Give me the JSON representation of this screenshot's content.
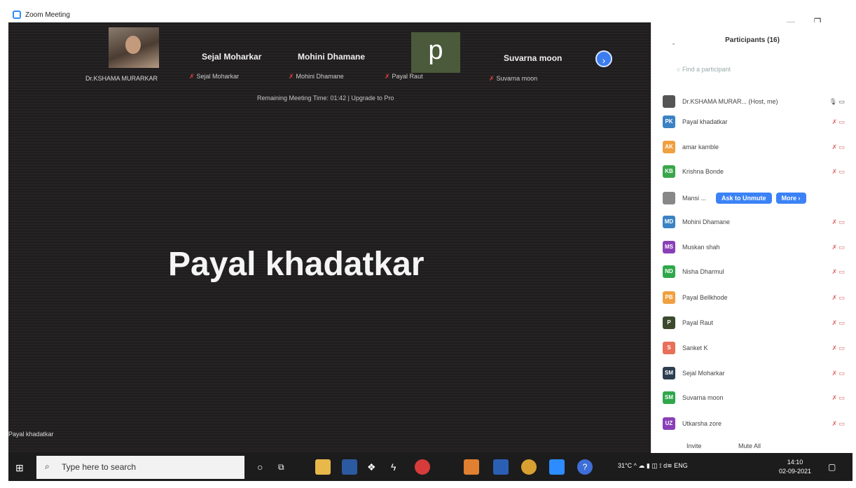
{
  "window": {
    "title": "Zoom Meeting"
  },
  "thumbnails": [
    {
      "name": "Dr.KSHAMA MURARKAR"
    },
    {
      "name": "Sejal Moharkar",
      "sub": "Sejal Moharkar"
    },
    {
      "name": "Mohini Dhamane",
      "sub": "Mohini Dhamane"
    },
    {
      "name": "p",
      "sub": "Payal Raut"
    },
    {
      "name": "Suvarna moon",
      "sub": "Suvarna moon"
    }
  ],
  "next_icon": "›",
  "remaining": "Remaining Meeting Time: 01:42 | Upgrade to Pro",
  "active_speaker": "Payal khadatkar",
  "active_label": "Payal khadatkar",
  "panel": {
    "title": "Participants (16)",
    "find_placeholder": "Find a participant",
    "participants": [
      {
        "initials": "",
        "name": "Dr.KSHAMA MURAR...  (Host, me)",
        "color": "#555555"
      },
      {
        "initials": "PK",
        "name": "Payal khadatkar",
        "color": "#3b82c4"
      },
      {
        "initials": "AK",
        "name": "amar kamble",
        "color": "#f0a040"
      },
      {
        "initials": "KB",
        "name": "Krishna Bonde",
        "color": "#3aa64a"
      },
      {
        "initials": "",
        "name": "Mansi ...",
        "color": "#888888"
      },
      {
        "initials": "MD",
        "name": "Mohini Dhamane",
        "color": "#3b82c4"
      },
      {
        "initials": "MS",
        "name": "Muskan shah",
        "color": "#8a3fb8"
      },
      {
        "initials": "ND",
        "name": "Nisha Dharmul",
        "color": "#2fa84a"
      },
      {
        "initials": "PB",
        "name": "Payal Bellkhode",
        "color": "#f0a040"
      },
      {
        "initials": "P",
        "name": "Payal Raut",
        "color": "#3c4a2c"
      },
      {
        "initials": "S",
        "name": "Sanket K",
        "color": "#e8705a"
      },
      {
        "initials": "SM",
        "name": "Sejal Moharkar",
        "color": "#2c3e50"
      },
      {
        "initials": "SM",
        "name": "Suvarna moon",
        "color": "#2fa84a"
      },
      {
        "initials": "UZ",
        "name": "Utkarsha zore",
        "color": "#8a3fb8"
      }
    ],
    "ask_unmute": "Ask to Unmute",
    "more": "More ›",
    "invite": "Invite",
    "mute_all": "Mute All"
  },
  "taskbar": {
    "search_placeholder": "Type here to search",
    "tray": "31°C  ^ ☁ ▮ ◫ ⟟ d≋ ENG",
    "time": "14:10",
    "date": "02-09-2021"
  }
}
